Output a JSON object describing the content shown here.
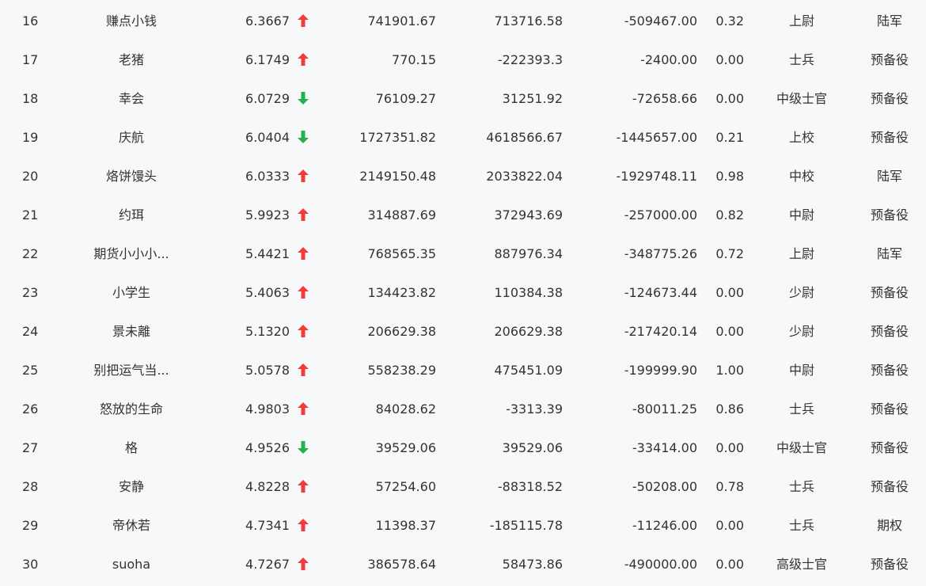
{
  "colors": {
    "up": "#f23c3c",
    "down": "#22b14c",
    "text": "#333333",
    "background": "#f7f8fa"
  },
  "rows": [
    {
      "rank": "16",
      "name": "赚点小钱",
      "score": "6.3667",
      "trend": "up",
      "value1": "741901.67",
      "value2": "713716.58",
      "value3": "-509467.00",
      "ratio": "0.32",
      "rank_title": "上尉",
      "type": "陆军"
    },
    {
      "rank": "17",
      "name": "老猪",
      "score": "6.1749",
      "trend": "up",
      "value1": "770.15",
      "value2": "-222393.3",
      "value3": "-2400.00",
      "ratio": "0.00",
      "rank_title": "士兵",
      "type": "预备役"
    },
    {
      "rank": "18",
      "name": "幸会",
      "score": "6.0729",
      "trend": "down",
      "value1": "76109.27",
      "value2": "31251.92",
      "value3": "-72658.66",
      "ratio": "0.00",
      "rank_title": "中级士官",
      "type": "预备役"
    },
    {
      "rank": "19",
      "name": "庆航",
      "score": "6.0404",
      "trend": "down",
      "value1": "1727351.82",
      "value2": "4618566.67",
      "value3": "-1445657.00",
      "ratio": "0.21",
      "rank_title": "上校",
      "type": "预备役"
    },
    {
      "rank": "20",
      "name": "烙饼馒头",
      "score": "6.0333",
      "trend": "up",
      "value1": "2149150.48",
      "value2": "2033822.04",
      "value3": "-1929748.11",
      "ratio": "0.98",
      "rank_title": "中校",
      "type": "陆军"
    },
    {
      "rank": "21",
      "name": "约珥",
      "score": "5.9923",
      "trend": "up",
      "value1": "314887.69",
      "value2": "372943.69",
      "value3": "-257000.00",
      "ratio": "0.82",
      "rank_title": "中尉",
      "type": "预备役"
    },
    {
      "rank": "22",
      "name": "期货小小小...",
      "score": "5.4421",
      "trend": "up",
      "value1": "768565.35",
      "value2": "887976.34",
      "value3": "-348775.26",
      "ratio": "0.72",
      "rank_title": "上尉",
      "type": "陆军"
    },
    {
      "rank": "23",
      "name": "小学生",
      "score": "5.4063",
      "trend": "up",
      "value1": "134423.82",
      "value2": "110384.38",
      "value3": "-124673.44",
      "ratio": "0.00",
      "rank_title": "少尉",
      "type": "预备役"
    },
    {
      "rank": "24",
      "name": "景未離",
      "score": "5.1320",
      "trend": "up",
      "value1": "206629.38",
      "value2": "206629.38",
      "value3": "-217420.14",
      "ratio": "0.00",
      "rank_title": "少尉",
      "type": "预备役"
    },
    {
      "rank": "25",
      "name": "别把运气当...",
      "score": "5.0578",
      "trend": "up",
      "value1": "558238.29",
      "value2": "475451.09",
      "value3": "-199999.90",
      "ratio": "1.00",
      "rank_title": "中尉",
      "type": "预备役"
    },
    {
      "rank": "26",
      "name": "怒放的生命",
      "score": "4.9803",
      "trend": "up",
      "value1": "84028.62",
      "value2": "-3313.39",
      "value3": "-80011.25",
      "ratio": "0.86",
      "rank_title": "士兵",
      "type": "预备役"
    },
    {
      "rank": "27",
      "name": "格",
      "score": "4.9526",
      "trend": "down",
      "value1": "39529.06",
      "value2": "39529.06",
      "value3": "-33414.00",
      "ratio": "0.00",
      "rank_title": "中级士官",
      "type": "预备役"
    },
    {
      "rank": "28",
      "name": "安静",
      "score": "4.8228",
      "trend": "up",
      "value1": "57254.60",
      "value2": "-88318.52",
      "value3": "-50208.00",
      "ratio": "0.78",
      "rank_title": "士兵",
      "type": "预备役"
    },
    {
      "rank": "29",
      "name": "帝休若",
      "score": "4.7341",
      "trend": "up",
      "value1": "11398.37",
      "value2": "-185115.78",
      "value3": "-11246.00",
      "ratio": "0.00",
      "rank_title": "士兵",
      "type": "期权"
    },
    {
      "rank": "30",
      "name": "suoha",
      "score": "4.7267",
      "trend": "up",
      "value1": "386578.64",
      "value2": "58473.86",
      "value3": "-490000.00",
      "ratio": "0.00",
      "rank_title": "高级士官",
      "type": "预备役"
    }
  ]
}
